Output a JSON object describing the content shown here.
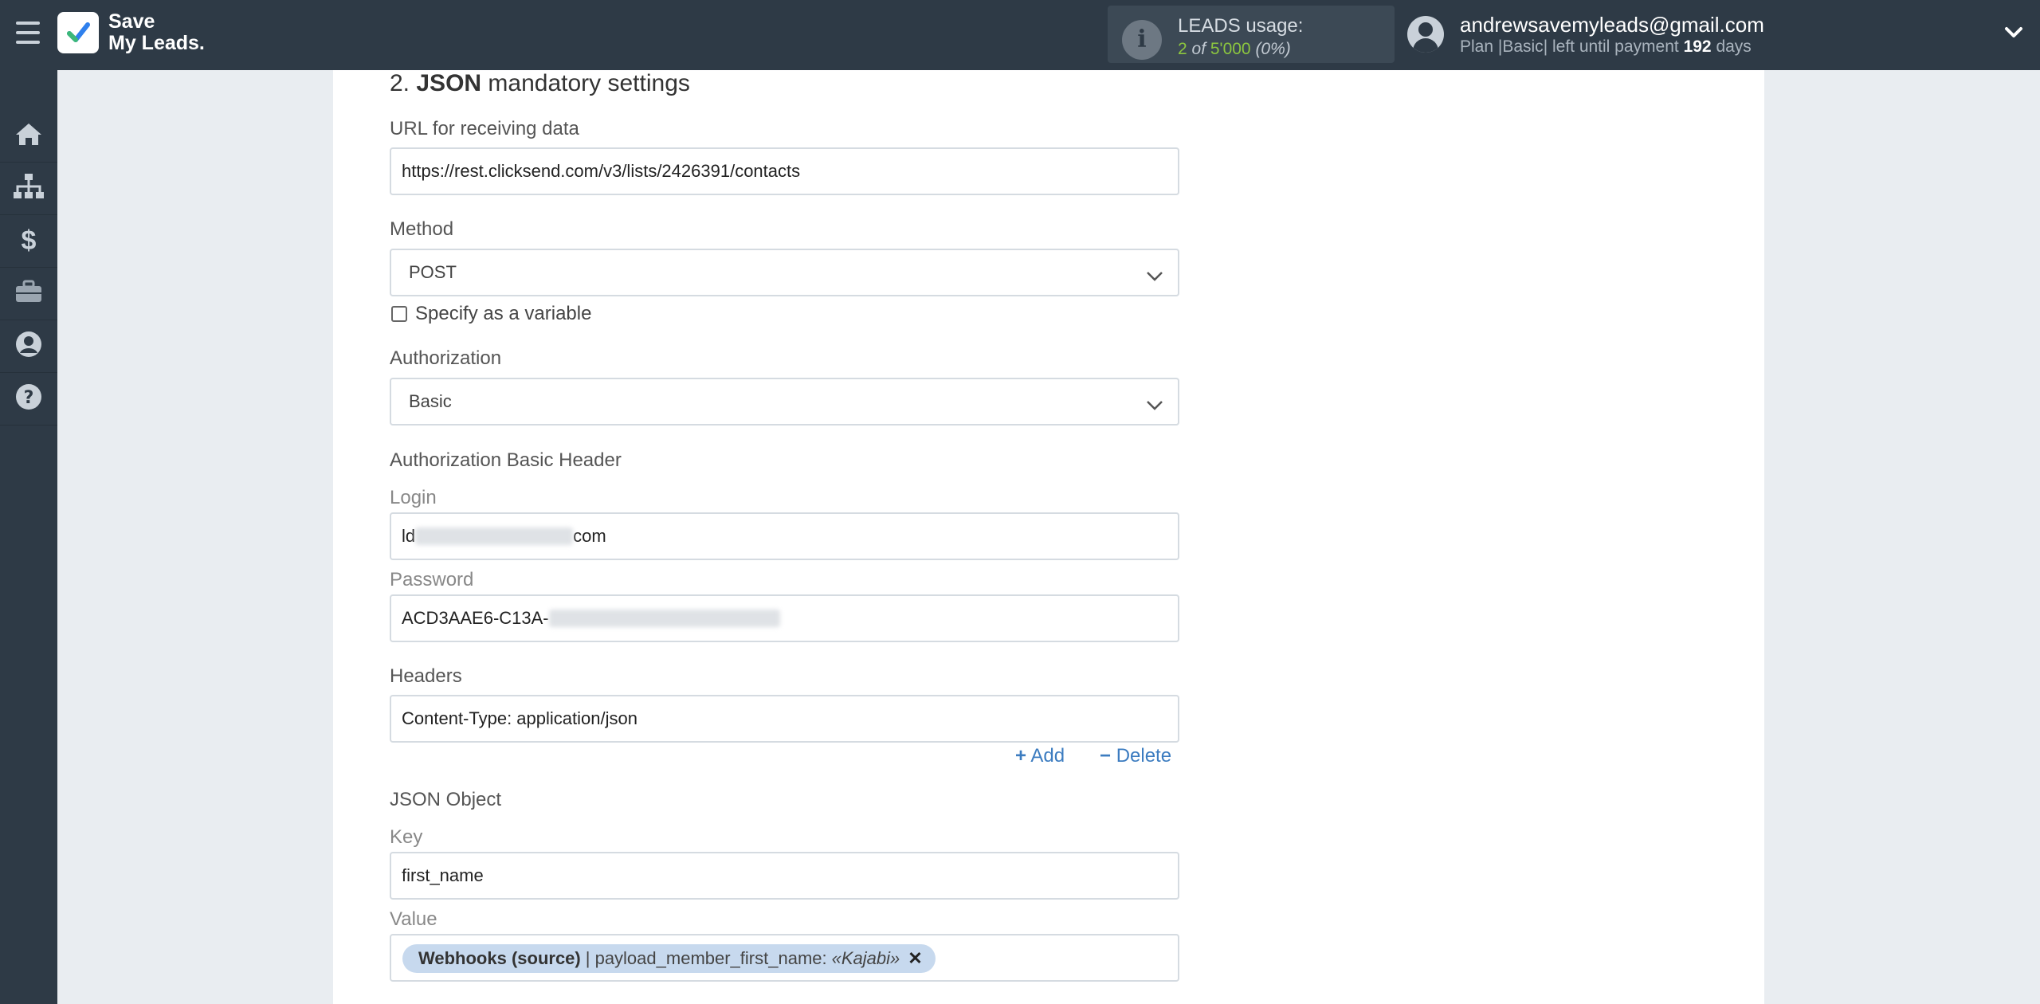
{
  "header": {
    "logo_line1": "Save",
    "logo_line2": "My Leads.",
    "leads_label": "LEADS usage:",
    "leads_used": "2",
    "leads_of": " of ",
    "leads_total": "5'000",
    "leads_percent": " (0%)",
    "user_email": "andrewsavemyleads@gmail.com",
    "plan_prefix": "Plan |",
    "plan_name": "Basic",
    "plan_suffix": "| left until payment ",
    "days_left": "192",
    "days_unit": " days"
  },
  "sidebar": {
    "items": [
      {
        "icon": "home-icon"
      },
      {
        "icon": "sitemap-icon"
      },
      {
        "icon": "dollar-icon"
      },
      {
        "icon": "briefcase-icon"
      },
      {
        "icon": "user-circle-icon"
      },
      {
        "icon": "help-icon"
      }
    ]
  },
  "form": {
    "section_number": "2.",
    "section_bold": "JSON",
    "section_rest": " mandatory settings",
    "url_label": "URL for receiving data",
    "url_value": "https://rest.clicksend.com/v3/lists/2426391/contacts",
    "method_label": "Method",
    "method_value": "POST",
    "specify_variable_label": "Specify as a variable",
    "authorization_label": "Authorization",
    "authorization_value": "Basic",
    "auth_header_label": "Authorization Basic Header",
    "login_label": "Login",
    "login_value_start": "ld",
    "login_value_end": "com",
    "password_label": "Password",
    "password_value_start": "ACD3AAE6-C13A-",
    "headers_label": "Headers",
    "headers_value": "Content-Type: application/json",
    "add_label": "Add",
    "delete_label": "Delete",
    "json_object_label": "JSON Object",
    "key_label": "Key",
    "key_value": "first_name",
    "value_label": "Value",
    "value_tag_source": "Webhooks (source)",
    "value_tag_field": "| payload_member_first_name: ",
    "value_tag_sample": "«Kajabi»",
    "value_tag_remove": "✕"
  },
  "colors": {
    "topbar": "#2e3a46",
    "accent_blue": "#3c7cc0",
    "leads_green": "#8cc63f",
    "tag_bg": "#c7d9ee"
  }
}
